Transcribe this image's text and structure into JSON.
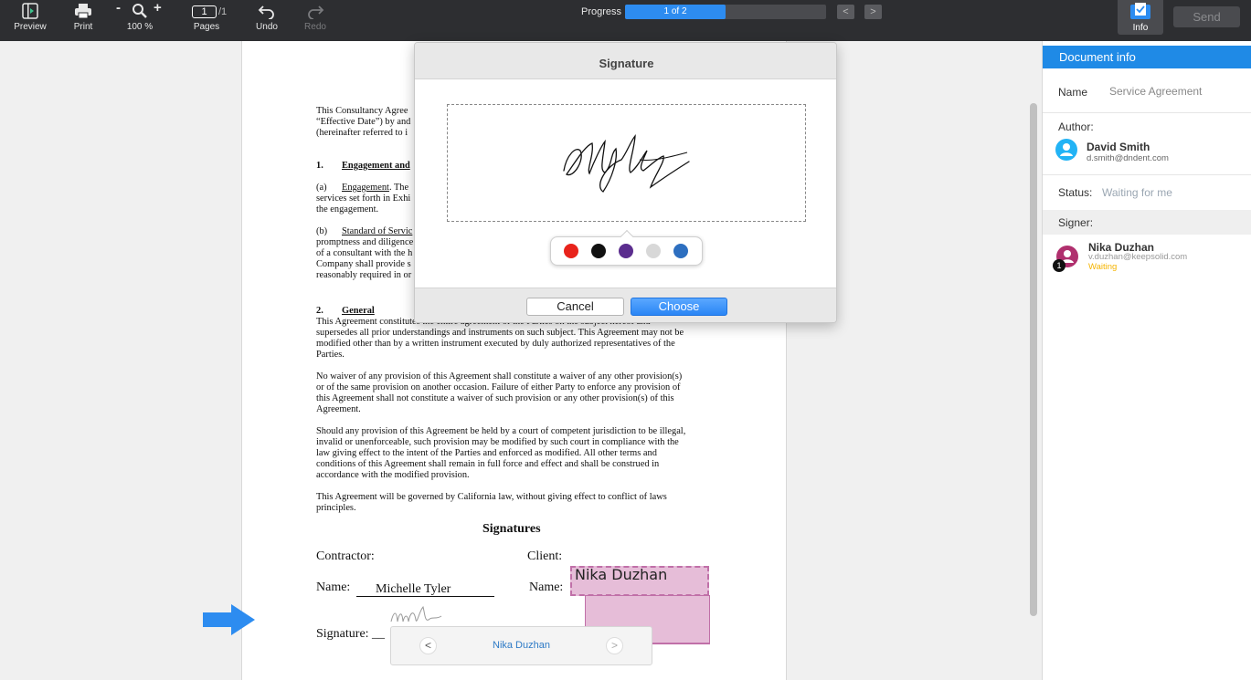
{
  "toolbar": {
    "preview": "Preview",
    "print": "Print",
    "zoom": "100 %",
    "zoom_minus": "-",
    "zoom_plus": "+",
    "page_current": "1",
    "page_total": "/1",
    "pages": "Pages",
    "undo": "Undo",
    "redo": "Redo",
    "progress_label": "Progress",
    "progress_text": "1 of 2",
    "progress_fraction": 0.5,
    "prev_arrow": "<",
    "next_arrow": ">",
    "info": "Info",
    "send": "Send"
  },
  "document": {
    "intro": [
      "This Consultancy Agree",
      "“Effective Date”) by and",
      "(hereinafter referred to i"
    ],
    "s1_num": "1.",
    "s1_title": "Engagement and",
    "a_label": "(a)",
    "a_title": "Engagement",
    "a_lines": [
      ". The",
      "services set forth in Exhi",
      "the engagement."
    ],
    "b_label": "(b)",
    "b_title": "Standard of Servic",
    "b_lines": [
      "promptness and diligence",
      "of a consultant with the h",
      "Company shall provide s",
      "reasonably required in or"
    ],
    "s2_num": "2.",
    "s2_title": "General",
    "p1": [
      "This Agreement constitutes the entire agreement of the Parties on the subject hereof and",
      "supersedes all prior understandings and instruments on such subject. This Agreement may not be",
      "modified other than by a written instrument executed by duly authorized representatives of the",
      "Parties."
    ],
    "p2": [
      "No waiver of any provision of this Agreement shall constitute a waiver of any other provision(s)",
      "or of the same provision on another occasion. Failure of either Party to enforce any provision of",
      "this Agreement shall not constitute a waiver of such provision or any other provision(s) of this",
      "Agreement."
    ],
    "p3": [
      "Should any provision of this Agreement be held by a court of competent jurisdiction to be illegal,",
      "invalid or unenforceable, such provision may be modified by such court in compliance with the",
      "law giving effect to the intent of the Parties and enforced as modified. All other terms and",
      "conditions of this Agreement shall remain in full force and effect and shall be construed in",
      "accordance with the modified provision."
    ],
    "p4": [
      "This Agreement will be governed by California law, without giving effect to conflict of laws",
      "principles."
    ],
    "signatures_heading": "Signatures",
    "contractor_label": "Contractor:",
    "client_label": "Client:",
    "name_label": "Name:",
    "contractor_name": "Michelle Tyler",
    "client_name_label": "Name:",
    "client_name_field": "Nika Duzhan",
    "signature_label": "Signature: __"
  },
  "signer_nav": {
    "name": "Nika Duzhan",
    "prev": "<",
    "next": ">"
  },
  "dialog": {
    "title": "Signature",
    "colors": [
      "#e8231b",
      "#111111",
      "#5b2d8e",
      "#d8d8d8",
      "#2d6fc0"
    ],
    "cancel": "Cancel",
    "choose": "Choose"
  },
  "info_panel": {
    "header": "Document info",
    "name_label": "Name",
    "name_value": "Service Agreement",
    "author_label": "Author:",
    "author_name": "David Smith",
    "author_email": "d.smith@dndent.com",
    "status_label": "Status:",
    "status_value": "Waiting for me",
    "signer_label": "Signer:",
    "signer_name": "Nika Duzhan",
    "signer_email": "v.duzhan@keepsolid.com",
    "signer_status": "Waiting",
    "signer_order": "1"
  }
}
